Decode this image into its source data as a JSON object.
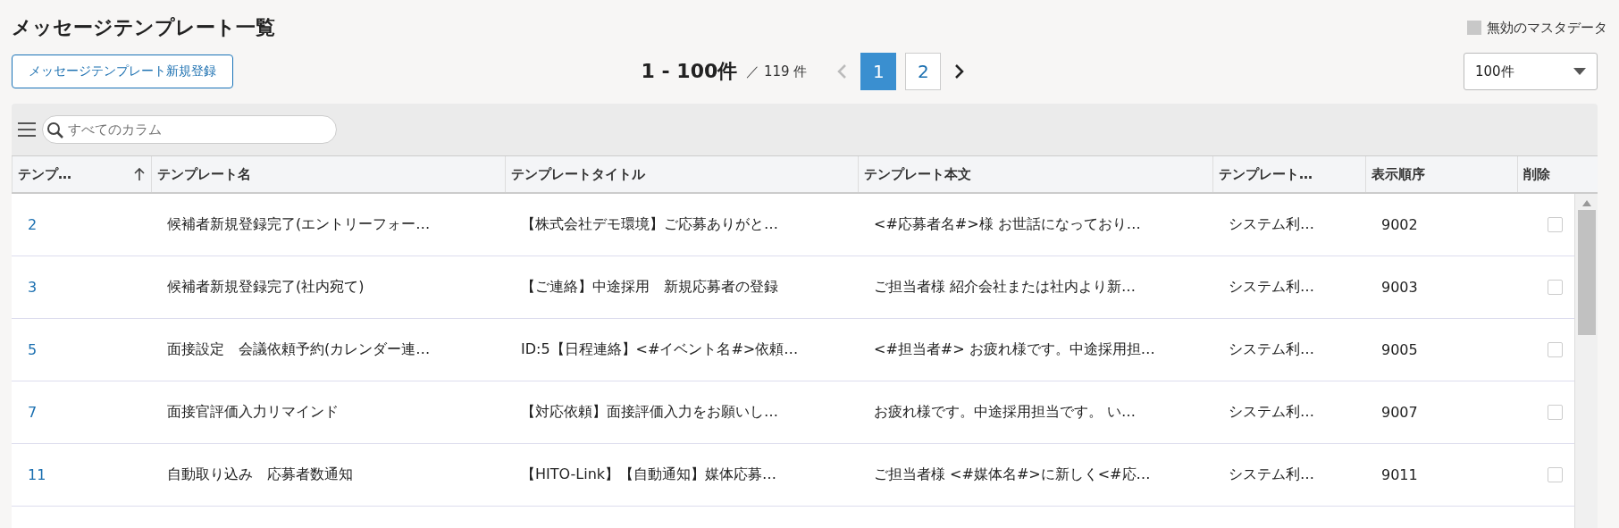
{
  "page": {
    "title": "メッセージテンプレート一覧",
    "legend": "無効のマスタデータ"
  },
  "new_button": "メッセージテンプレート新規登録",
  "pagination": {
    "range": "1 - 100件",
    "total": "／ 119 件",
    "prev_disabled": true,
    "pages": [
      {
        "label": "1",
        "selected": true
      },
      {
        "label": "2",
        "selected": false
      }
    ]
  },
  "page_size": "100件",
  "search": {
    "placeholder": "すべてのカラム"
  },
  "table": {
    "columns": [
      {
        "label": "テンプ…",
        "sorted": true
      },
      {
        "label": "テンプレート名",
        "sorted": false
      },
      {
        "label": "テンプレートタイトル",
        "sorted": false
      },
      {
        "label": "テンプレート本文",
        "sorted": false
      },
      {
        "label": "テンプレート…",
        "sorted": false
      },
      {
        "label": "表示順序",
        "sorted": false
      },
      {
        "label": "削除",
        "sorted": false
      }
    ],
    "rows": [
      {
        "id": "2",
        "name": "候補者新規登録完了(エントリーフォー…",
        "title": "【株式会社デモ環境】ご応募ありがと…",
        "body": "<#応募者名#>様 お世話になっており…",
        "type": "システム利…",
        "order": "9002",
        "deleted": false
      },
      {
        "id": "3",
        "name": "候補者新規登録完了(社内宛て)",
        "title": "【ご連絡】中途採用　新規応募者の登録",
        "body": "ご担当者様 紹介会社または社内より新…",
        "type": "システム利…",
        "order": "9003",
        "deleted": false
      },
      {
        "id": "5",
        "name": "面接設定　会議依頼予約(カレンダー連…",
        "title": "ID:5【日程連絡】<#イベント名#>依頼…",
        "body": "<#担当者#> お疲れ様です。中途採用担…",
        "type": "システム利…",
        "order": "9005",
        "deleted": false
      },
      {
        "id": "7",
        "name": "面接官評価入力リマインド",
        "title": "【対応依頼】面接評価入力をお願いし…",
        "body": "お疲れ様です。中途採用担当です。 い…",
        "type": "システム利…",
        "order": "9007",
        "deleted": false
      },
      {
        "id": "11",
        "name": "自動取り込み　応募者数通知",
        "title": "【HITO-Link】【自動通知】媒体応募…",
        "body": "ご担当者様 <#媒体名#>に新しく<#応…",
        "type": "システム利…",
        "order": "9011",
        "deleted": false
      }
    ]
  }
}
